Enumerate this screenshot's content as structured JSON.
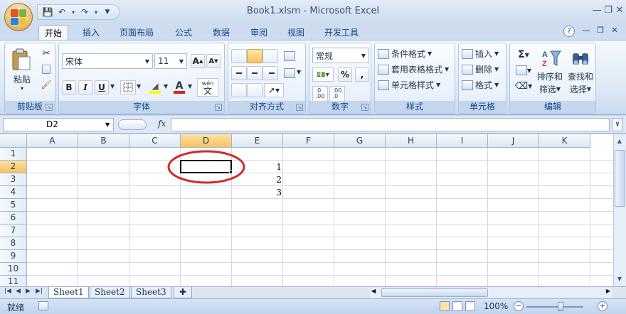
{
  "window": {
    "title": "Book1.xlsm - Microsoft Excel"
  },
  "colors": {
    "accent": "#15428b",
    "selected_header": "#f7c25d",
    "annotation": "#d42a2a"
  },
  "tabs": [
    "开始",
    "插入",
    "页面布局",
    "公式",
    "数据",
    "审阅",
    "视图",
    "开发工具"
  ],
  "ribbon": {
    "clipboard": {
      "label": "剪贴板",
      "paste": "粘贴"
    },
    "font": {
      "label": "字体",
      "name": "宋体",
      "size": "11",
      "bold": "B",
      "italic": "I",
      "underline": "U",
      "font_color": "A",
      "wen": "wén",
      "wen_char": "文",
      "grow": "A",
      "shrink": "A"
    },
    "alignment": {
      "label": "对齐方式"
    },
    "number": {
      "label": "数字",
      "format": "常规",
      "percent": "%",
      "comma": ",",
      "inc_decimal": ".0\n.00",
      "dec_decimal": ".00\n.0"
    },
    "styles": {
      "label": "样式",
      "conditional": "条件格式",
      "table": "套用表格格式",
      "cell": "单元格样式"
    },
    "cells": {
      "label": "单元格",
      "insert": "插入",
      "delete": "删除",
      "format": "格式"
    },
    "editing": {
      "label": "编辑",
      "sort": "排序和",
      "sort2": "筛选",
      "find": "查找和",
      "find2": "选择",
      "sigma": "Σ"
    }
  },
  "formula_bar": {
    "name_box": "D2",
    "fx": "fx",
    "value": ""
  },
  "columns": [
    "A",
    "B",
    "C",
    "D",
    "E",
    "F",
    "G",
    "H",
    "I",
    "J",
    "K"
  ],
  "rows": [
    "1",
    "2",
    "3",
    "4",
    "5",
    "6",
    "7",
    "8",
    "9",
    "10",
    "11"
  ],
  "selected_cell": "D2",
  "cells": {
    "E2": "1",
    "E3": "2",
    "E4": "3"
  },
  "sheets": [
    "Sheet1",
    "Sheet2",
    "Sheet3"
  ],
  "active_sheet": "Sheet1",
  "status": {
    "mode": "就绪",
    "zoom": "100%",
    "zoom_out": "−",
    "zoom_in": "+"
  }
}
